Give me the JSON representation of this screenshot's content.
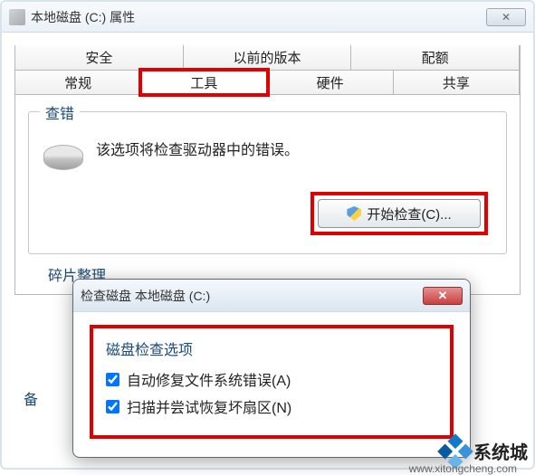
{
  "main": {
    "title": "本地磁盘 (C:) 属性",
    "close_symbol": "✕",
    "tabs_row1": [
      "安全",
      "以前的版本",
      "配额"
    ],
    "tabs_row2": [
      "常规",
      "工具",
      "硬件",
      "共享"
    ],
    "active_tab": "工具",
    "group_check": {
      "label": "查错",
      "desc": "该选项将检查驱动器中的错误。",
      "button": "开始检查(C)..."
    },
    "defrag_label": "碎片整理",
    "left_trunc": "备"
  },
  "dialog": {
    "title": "检查磁盘 本地磁盘 (C:)",
    "close_symbol": "✕",
    "options_title": "磁盘检查选项",
    "checkbox1": "自动修复文件系统错误(A)",
    "checkbox2": "扫描并尝试恢复坏扇区(N)"
  },
  "watermark": {
    "brand": "系统城",
    "url": "www.xitongcheng.com"
  }
}
